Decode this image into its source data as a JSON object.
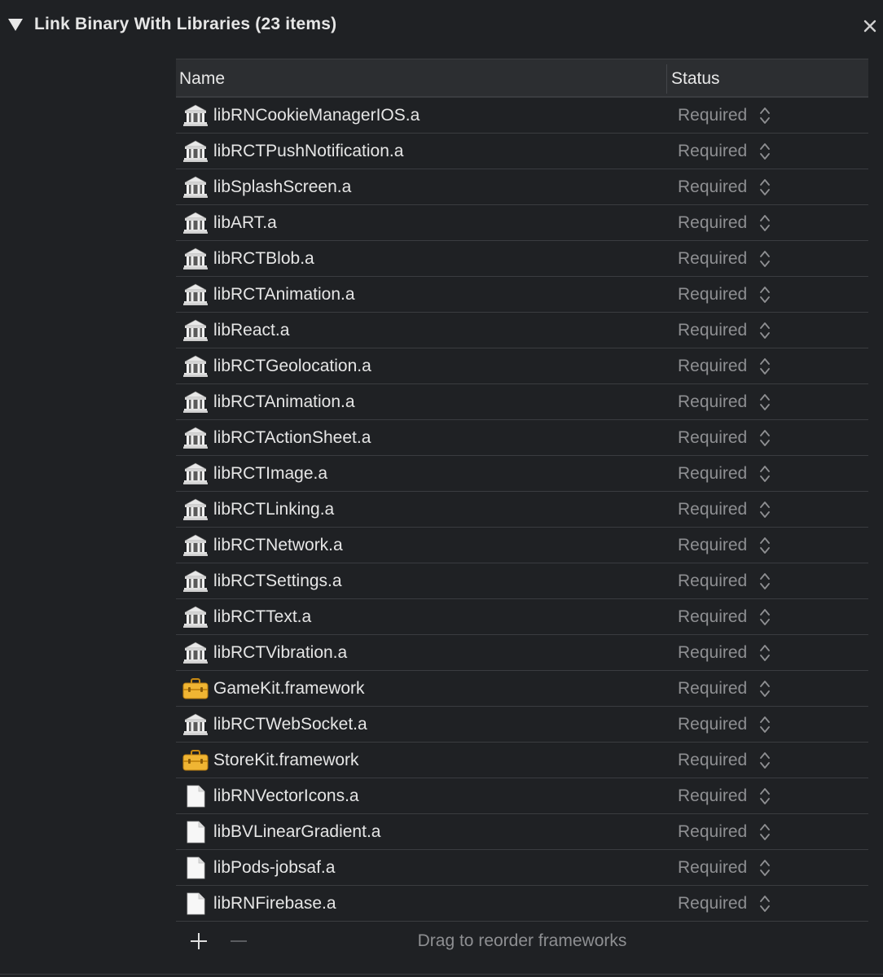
{
  "section": {
    "title": "Link Binary With Libraries (23 items)"
  },
  "table": {
    "columns": {
      "name": "Name",
      "status": "Status"
    },
    "rows": [
      {
        "name": "libRNCookieManagerIOS.a",
        "status": "Required",
        "icon": "library-icon"
      },
      {
        "name": "libRCTPushNotification.a",
        "status": "Required",
        "icon": "library-icon"
      },
      {
        "name": "libSplashScreen.a",
        "status": "Required",
        "icon": "library-icon"
      },
      {
        "name": "libART.a",
        "status": "Required",
        "icon": "library-icon"
      },
      {
        "name": "libRCTBlob.a",
        "status": "Required",
        "icon": "library-icon"
      },
      {
        "name": "libRCTAnimation.a",
        "status": "Required",
        "icon": "library-icon"
      },
      {
        "name": "libReact.a",
        "status": "Required",
        "icon": "library-icon"
      },
      {
        "name": "libRCTGeolocation.a",
        "status": "Required",
        "icon": "library-icon"
      },
      {
        "name": "libRCTAnimation.a",
        "status": "Required",
        "icon": "library-icon"
      },
      {
        "name": "libRCTActionSheet.a",
        "status": "Required",
        "icon": "library-icon"
      },
      {
        "name": "libRCTImage.a",
        "status": "Required",
        "icon": "library-icon"
      },
      {
        "name": "libRCTLinking.a",
        "status": "Required",
        "icon": "library-icon"
      },
      {
        "name": "libRCTNetwork.a",
        "status": "Required",
        "icon": "library-icon"
      },
      {
        "name": "libRCTSettings.a",
        "status": "Required",
        "icon": "library-icon"
      },
      {
        "name": "libRCTText.a",
        "status": "Required",
        "icon": "library-icon"
      },
      {
        "name": "libRCTVibration.a",
        "status": "Required",
        "icon": "library-icon"
      },
      {
        "name": "GameKit.framework",
        "status": "Required",
        "icon": "framework-icon"
      },
      {
        "name": "libRCTWebSocket.a",
        "status": "Required",
        "icon": "library-icon"
      },
      {
        "name": "StoreKit.framework",
        "status": "Required",
        "icon": "framework-icon"
      },
      {
        "name": "libRNVectorIcons.a",
        "status": "Required",
        "icon": "file-icon"
      },
      {
        "name": "libBVLinearGradient.a",
        "status": "Required",
        "icon": "file-icon"
      },
      {
        "name": "libPods-jobsaf.a",
        "status": "Required",
        "icon": "file-icon"
      },
      {
        "name": "libRNFirebase.a",
        "status": "Required",
        "icon": "file-icon"
      }
    ]
  },
  "footer": {
    "hint": "Drag to reorder frameworks"
  }
}
